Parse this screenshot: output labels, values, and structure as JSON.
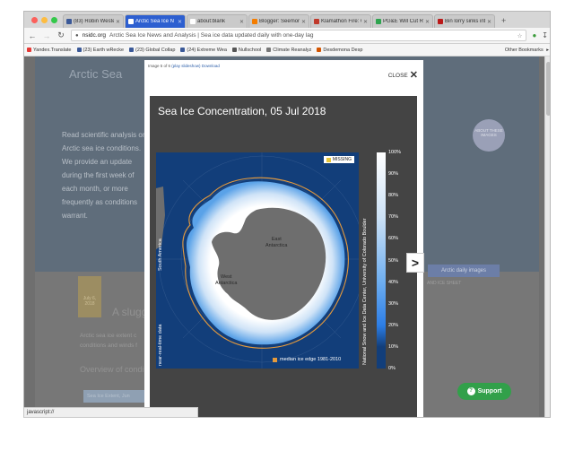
{
  "browser": {
    "tabs": [
      {
        "label": "(83) Robin Westen",
        "color": "#3b5998"
      },
      {
        "label": "Arctic Sea Ice N",
        "color": "#ffffff",
        "active": true
      },
      {
        "label": "about:blank",
        "color": "#ffffff"
      },
      {
        "label": "Blogger: Seemorr",
        "color": "#f57d00"
      },
      {
        "label": "Klamathon Fire: O",
        "color": "#c0392b"
      },
      {
        "label": "PG&E Will Cut Res",
        "color": "#2ea44f"
      },
      {
        "label": "Bin lorry sinks into",
        "color": "#bb1919"
      }
    ],
    "new_tab": "+",
    "url_host": "nsidc.org",
    "url_title": "Arctic Sea Ice News and Analysis | Sea ice data updated daily with one-day lag",
    "bookmarks": [
      {
        "label": "Yandex.Translate",
        "color": "#e53935"
      },
      {
        "label": "(23) Earth wRecke",
        "color": "#3b5998"
      },
      {
        "label": "(23) Global Collap",
        "color": "#3b5998"
      },
      {
        "label": "(24) Extreme Wea",
        "color": "#3b5998"
      },
      {
        "label": "Nullschool",
        "color": "#555555"
      },
      {
        "label": "Climate Reanalyz",
        "color": "#777777"
      },
      {
        "label": "Desdemona Desp",
        "color": "#d35400"
      }
    ],
    "other_bookmarks": "Other Bookmarks",
    "status_text": "javascript://"
  },
  "background": {
    "title": "Arctic Sea",
    "intro": "Read scientific analysis on Arctic sea ice conditions. We provide an update during the first week of each month, or more frequently as conditions warrant.",
    "about_circle": "ABOUT THESE IMAGES",
    "daily_images_button": "Arctic daily images",
    "date_badge": "July 6, 2018",
    "subtitle": "A sluggi",
    "lines": "Arctic sea ice extent c\nconditions and winds f",
    "overview": "Overview of conditio",
    "extent_box": "Sea Ice Extent, Jun",
    "right_label": "AND ICE SHEET"
  },
  "lightbox": {
    "info_prefix": "Image 5 of 6",
    "slideshow_link": "(play slideshow)",
    "download_link": "Download",
    "close_label": "CLOSE",
    "next_label": ">"
  },
  "figure": {
    "title": "Sea Ice Concentration, 05 Jul 2018",
    "missing_label": "MISSING",
    "east_antarctica": "East\nAntarctica",
    "west_antarctica": "West\nAntarctica",
    "south_america": "South America",
    "nrt_label": "near-real-time data",
    "median_label": "median ice edge 1981-2010",
    "credit": "National Snow and Ice Data Center, University of Colorado Boulder",
    "colorbar_ticks": [
      "100%",
      "90%",
      "80%",
      "70%",
      "60%",
      "50%",
      "40%",
      "30%",
      "20%",
      "10%",
      "0%"
    ],
    "colors": {
      "open_water": "#123e7a",
      "ice_full": "#ffffff",
      "land": "#6e6e6e",
      "median_edge": "#e59a3c",
      "missing": "#e8c73a"
    }
  },
  "support_button": "Support"
}
